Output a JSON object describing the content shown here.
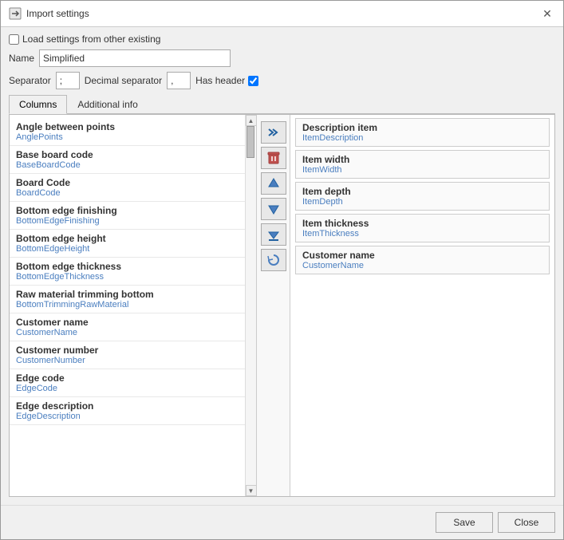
{
  "title": "Import settings",
  "close_label": "✕",
  "load_settings_label": "Load settings from other existing",
  "name_label": "Name",
  "name_value": "Simplified",
  "separator_label": "Separator",
  "separator_value": ";",
  "decimal_label": "Decimal separator",
  "decimal_value": ",",
  "has_header_label": "Has header",
  "tabs": [
    {
      "id": "columns",
      "label": "Columns",
      "active": true
    },
    {
      "id": "additional",
      "label": "Additional info",
      "active": false
    }
  ],
  "left_items": [
    {
      "name": "Angle between points",
      "code": "AnglePoints"
    },
    {
      "name": "Base board code",
      "code": "BaseBoardCode"
    },
    {
      "name": "Board Code",
      "code": "BoardCode"
    },
    {
      "name": "Bottom edge finishing",
      "code": "BottomEdgeFinishing"
    },
    {
      "name": "Bottom edge height",
      "code": "BottomEdgeHeight"
    },
    {
      "name": "Bottom edge thickness",
      "code": "BottomEdgeThickness"
    },
    {
      "name": "Raw material trimming bottom",
      "code": "BottomTrimmingRawMaterial"
    },
    {
      "name": "Customer name",
      "code": "CustomerName"
    },
    {
      "name": "Customer number",
      "code": "CustomerNumber"
    },
    {
      "name": "Edge code",
      "code": "EdgeCode"
    },
    {
      "name": "Edge description",
      "code": "EdgeDescription"
    }
  ],
  "middle_buttons": [
    {
      "id": "add-all",
      "icon": "»",
      "tooltip": "Add all"
    },
    {
      "id": "remove",
      "icon": "🗑",
      "tooltip": "Remove"
    },
    {
      "id": "move-up",
      "icon": "↑",
      "tooltip": "Move up"
    },
    {
      "id": "move-down",
      "icon": "↓",
      "tooltip": "Move down"
    },
    {
      "id": "move-first",
      "icon": "⇓",
      "tooltip": "Move to bottom"
    },
    {
      "id": "rotate",
      "icon": "↺",
      "tooltip": "Rotate"
    }
  ],
  "right_items": [
    {
      "name": "Description item",
      "code": "ItemDescription"
    },
    {
      "name": "Item width",
      "code": "ItemWidth"
    },
    {
      "name": "Item depth",
      "code": "ItemDepth"
    },
    {
      "name": "Item thickness",
      "code": "ItemThickness"
    },
    {
      "name": "Customer name",
      "code": "CustomerName"
    }
  ],
  "footer": {
    "save_label": "Save",
    "close_label": "Close"
  }
}
